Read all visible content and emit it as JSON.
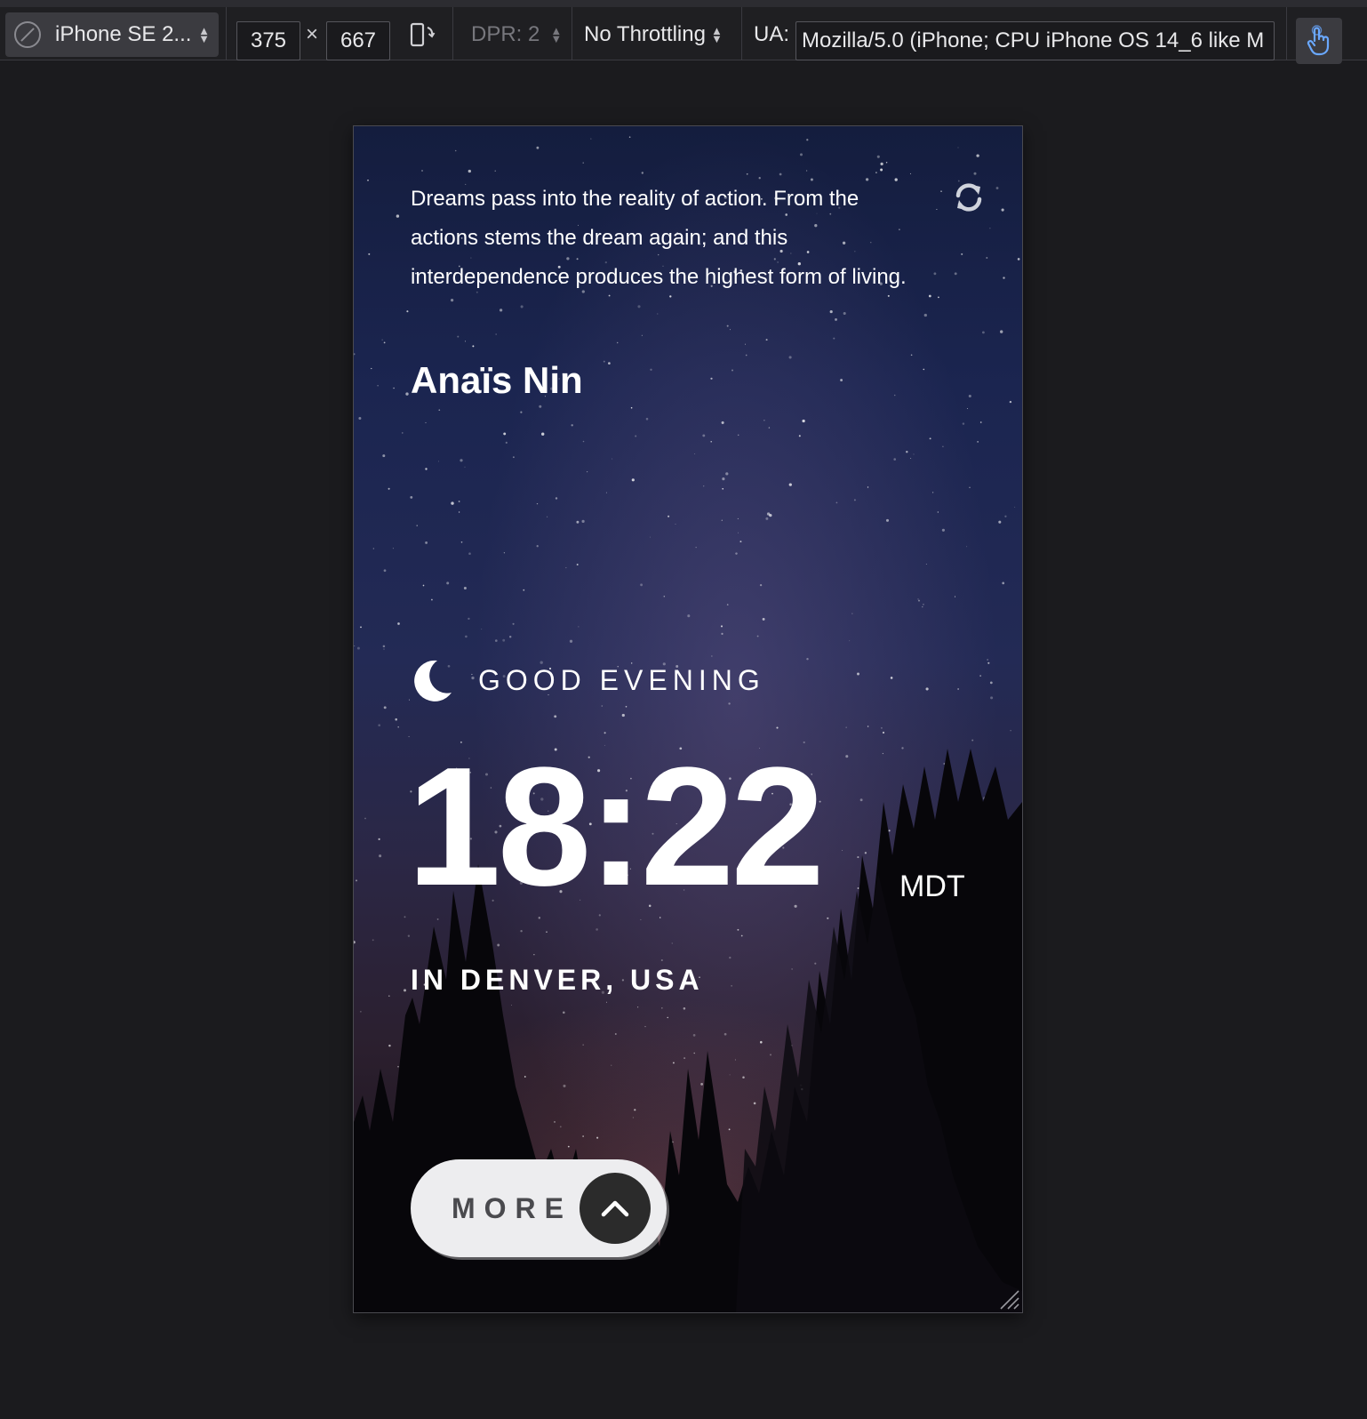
{
  "devtools": {
    "device_name": "iPhone SE 2...",
    "width": "375",
    "times": "×",
    "height": "667",
    "dpr": "DPR: 2",
    "throttling": "No Throttling",
    "ua_label": "UA:",
    "ua_value": "Mozilla/5.0 (iPhone; CPU iPhone OS 14_6 like M",
    "accent_color": "#6aa8ff"
  },
  "app": {
    "quote": "Dreams pass into the reality of action. From the actions stems the dream again; and this interdependence produces the highest form of living.",
    "author": "Anaïs Nin",
    "greeting": "GOOD EVENING",
    "greeting_icon": "moon-icon",
    "time": "18:22",
    "timezone": "MDT",
    "location": "IN DENVER, USA",
    "more_label": "MORE",
    "more_icon": "chevron-up-icon",
    "refresh_icon": "refresh-icon"
  }
}
